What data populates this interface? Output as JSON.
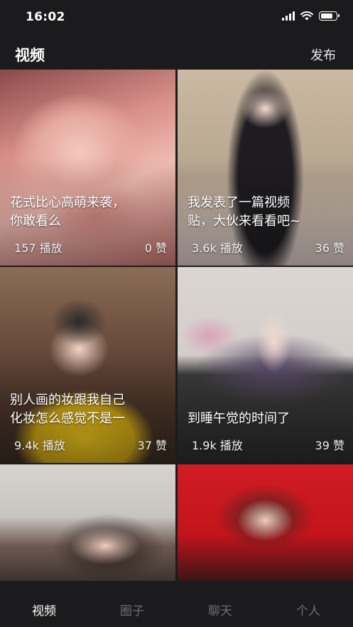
{
  "status_bar": {
    "time": "16:02"
  },
  "header": {
    "title": "视频",
    "publish_label": "发布"
  },
  "videos": [
    {
      "title": "花式比心高萌来袭，\n你敢看么",
      "plays": "157 播放",
      "likes": "0 赞"
    },
    {
      "title": "我发表了一篇视频\n贴，大伙来看看吧~",
      "plays": "3.6k 播放",
      "likes": "36 赞"
    },
    {
      "title": "别人画的妆跟我自己\n化妆怎么感觉不是一",
      "plays": "9.4k 播放",
      "likes": "37 赞"
    },
    {
      "title": "到睡午觉的时间了",
      "plays": "1.9k 播放",
      "likes": "39 赞"
    },
    {
      "title": "",
      "plays": "",
      "likes": ""
    },
    {
      "title": "",
      "plays": "",
      "likes": ""
    }
  ],
  "tabs": [
    {
      "label": "视频",
      "active": true
    },
    {
      "label": "圈子",
      "active": false
    },
    {
      "label": "聊天",
      "active": false
    },
    {
      "label": "个人",
      "active": false
    }
  ]
}
